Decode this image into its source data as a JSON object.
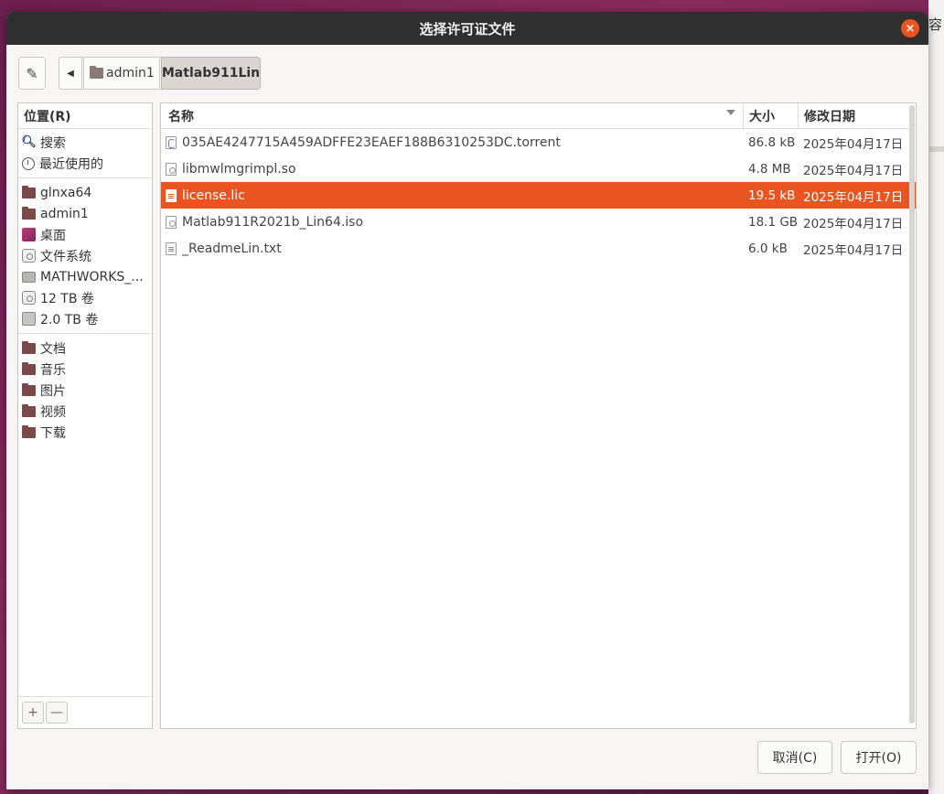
{
  "background": {
    "peek_text": "容"
  },
  "window": {
    "title": "选择许可证文件",
    "close_glyph": "×"
  },
  "toolbar": {
    "breadcrumbs": [
      {
        "label": "admin1"
      },
      {
        "label": "Matlab911Lin"
      }
    ]
  },
  "sidebar": {
    "header": "位置(R)",
    "groups": [
      [
        {
          "label": "搜索",
          "icon": "search-icon"
        },
        {
          "label": "最近使用的",
          "icon": "recent-icon"
        }
      ],
      [
        {
          "label": "glnxa64",
          "icon": "folder-icon"
        },
        {
          "label": "admin1",
          "icon": "home-folder-icon"
        },
        {
          "label": "桌面",
          "icon": "desktop-icon"
        },
        {
          "label": "文件系统",
          "icon": "filesystem-icon"
        },
        {
          "label": "MATHWORKS_...",
          "icon": "drive-icon"
        },
        {
          "label": "12 TB 卷",
          "icon": "disk-icon"
        },
        {
          "label": "2.0 TB 卷",
          "icon": "hdd-icon"
        }
      ],
      [
        {
          "label": "文档",
          "icon": "folder-icon"
        },
        {
          "label": "音乐",
          "icon": "folder-icon"
        },
        {
          "label": "图片",
          "icon": "folder-icon"
        },
        {
          "label": "视频",
          "icon": "folder-icon"
        },
        {
          "label": "下载",
          "icon": "folder-icon"
        }
      ]
    ],
    "footer": {
      "add_glyph": "+",
      "remove_glyph": "—"
    }
  },
  "filelist": {
    "columns": {
      "name": "名称",
      "size": "大小",
      "modified": "修改日期"
    },
    "rows": [
      {
        "name": "035AE4247715A459ADFFE23EAEF188B6310253DC.torrent",
        "size": "86.8 kB",
        "modified": "2025年04月17日",
        "type": "torrent",
        "selected": false
      },
      {
        "name": "libmwlmgrimpl.so",
        "size": "4.8 MB",
        "modified": "2025年04月17日",
        "type": "so",
        "selected": false
      },
      {
        "name": "license.lic",
        "size": "19.5 kB",
        "modified": "2025年04月17日",
        "type": "txt",
        "selected": true
      },
      {
        "name": "Matlab911R2021b_Lin64.iso",
        "size": "18.1 GB",
        "modified": "2025年04月17日",
        "type": "iso",
        "selected": false
      },
      {
        "name": "_ReadmeLin.txt",
        "size": "6.0 kB",
        "modified": "2025年04月17日",
        "type": "txt",
        "selected": false
      }
    ]
  },
  "buttons": {
    "cancel": "取消(C)",
    "open": "打开(O)"
  },
  "colors": {
    "accent": "#e95420",
    "titlebar": "#2f2f2f",
    "dialog_bg": "#f6f5f4"
  }
}
